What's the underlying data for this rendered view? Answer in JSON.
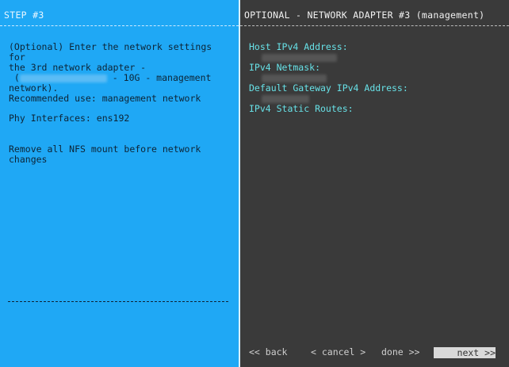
{
  "left": {
    "title": "STEP #3",
    "desc_line1": "(Optional) Enter the network settings for",
    "desc_line2": "the 3rd network adapter -",
    "desc_line3_suffix": "- 10G - management",
    "desc_line4": "network).",
    "recommended": "Recommended use: management network",
    "phy": "Phy Interfaces: ens192",
    "nfs_line1": "Remove all NFS mount before network",
    "nfs_line2": "changes"
  },
  "right": {
    "title": "OPTIONAL - NETWORK ADAPTER #3 (management)",
    "fields": [
      {
        "label": "Host IPv4 Address:"
      },
      {
        "label": "IPv4 Netmask:"
      },
      {
        "label": "Default Gateway IPv4 Address:"
      },
      {
        "label": "IPv4 Static Routes:"
      }
    ]
  },
  "nav": {
    "back": "<< back",
    "cancel": "< cancel >",
    "done": "done >>",
    "next": "next >>"
  }
}
